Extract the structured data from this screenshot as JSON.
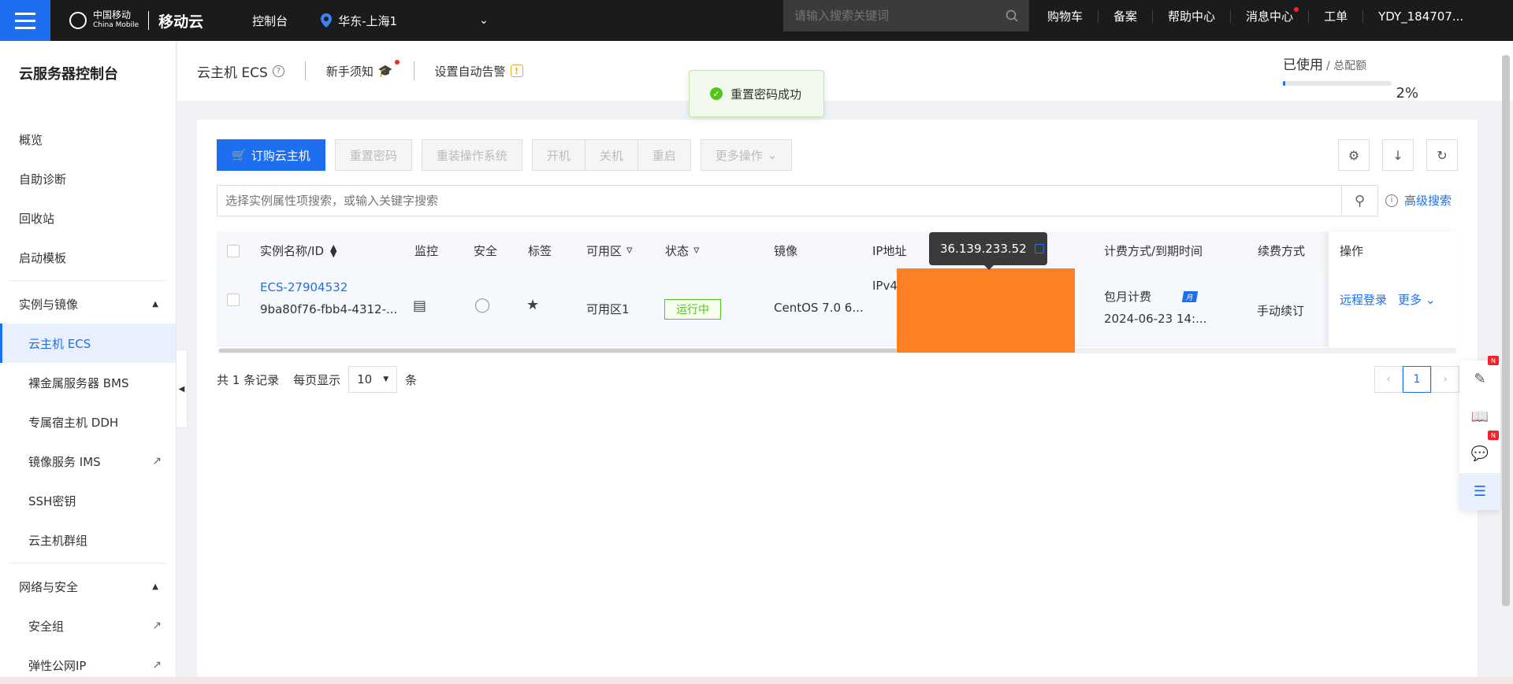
{
  "topbar": {
    "logo_cn": "中国移动",
    "logo_en": "China Mobile",
    "brand": "移动云",
    "console": "控制台",
    "region": "华东-上海1",
    "search_placeholder": "请输入搜索关键词",
    "links": [
      "购物车",
      "备案",
      "帮助中心",
      "消息中心",
      "工单",
      "YDY_184707..."
    ]
  },
  "sidebar": {
    "title": "云服务器控制台",
    "items": [
      "概览",
      "自助诊断",
      "回收站",
      "启动模板"
    ],
    "group1": "实例与镜像",
    "group1_items": [
      "云主机 ECS",
      "裸金属服务器 BMS",
      "专属宿主机 DDH",
      "镜像服务 IMS",
      "SSH密钥",
      "云主机群组"
    ],
    "group2": "网络与安全",
    "group2_items": [
      "安全组",
      "弹性公网IP"
    ]
  },
  "header": {
    "title": "云主机 ECS",
    "guide": "新手须知",
    "alarm": "设置自动告警",
    "usage_label": "已使用",
    "quota_label": "/ 总配额",
    "usage_pct": "2%",
    "usage_fraction": 0.02
  },
  "toast": {
    "message": "重置密码成功"
  },
  "toolbar": {
    "order": "订购云主机",
    "reset_pwd": "重置密码",
    "reinstall": "重装操作系统",
    "start": "开机",
    "stop": "关机",
    "restart": "重启",
    "more": "更多操作"
  },
  "search": {
    "placeholder": "选择实例属性项搜索，或输入关键字搜索",
    "advanced": "高级搜索"
  },
  "table": {
    "headers": [
      "实例名称/ID",
      "监控",
      "安全",
      "标签",
      "可用区",
      "状态",
      "镜像",
      "IP地址",
      "计费方式/到期时间",
      "续费方式",
      "操作"
    ],
    "row": {
      "name": "ECS-27904532",
      "id": "9ba80f76-fbb4-4312-...",
      "zone": "可用区1",
      "status": "运行中",
      "image": "CentOS 7.0 6...",
      "ip_prefix": "IPv4:",
      "billing": "包月计费",
      "expire": "2024-06-23 14:...",
      "renew": "手动续订",
      "op_login": "远程登录",
      "op_more": "更多"
    },
    "ip_tooltip": "36.139.233.52"
  },
  "pager": {
    "total": "共 1 条记录",
    "per_page_label": "每页显示",
    "per_page": "10",
    "unit": "条",
    "current": "1"
  },
  "colors": {
    "primary": "#1e6ff0",
    "success": "#52c41a",
    "topbar": "#1a1b1d"
  }
}
